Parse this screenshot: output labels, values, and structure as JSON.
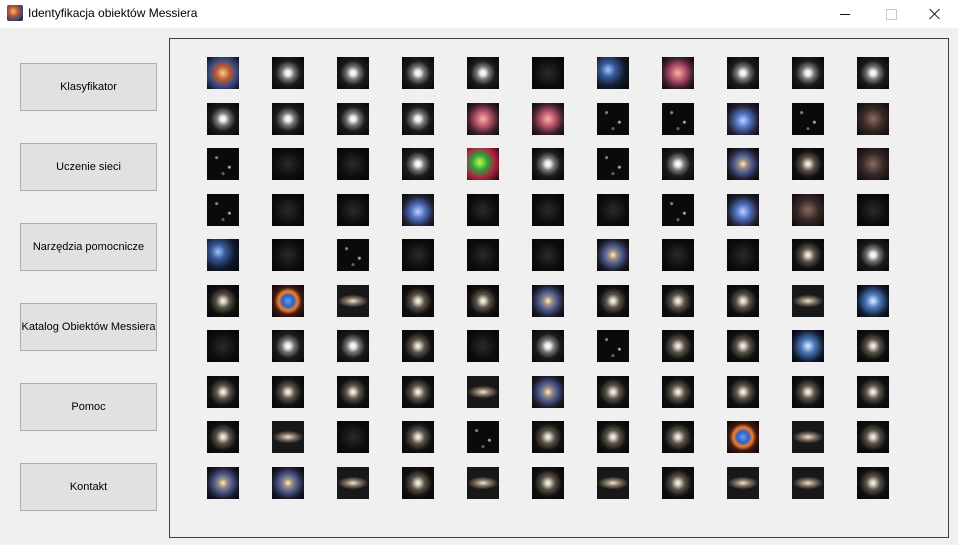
{
  "window": {
    "title": "Identyfikacja obiektów Messiera",
    "icon": "galaxy-app-icon",
    "controls": [
      "minimize-icon",
      "maximize-icon",
      "close-icon"
    ]
  },
  "sidebar": {
    "buttons": [
      {
        "label": "Klasyfikator"
      },
      {
        "label": "Uczenie sieci"
      },
      {
        "label": "Narzędzia pomocnicze"
      },
      {
        "label": "Katalog Obiektów Messiera"
      },
      {
        "label": "Pomoc"
      },
      {
        "label": "Kontakt"
      }
    ]
  },
  "gallery": {
    "rows": 10,
    "columns": 11,
    "thumbnail_count": 110,
    "thumbnails": [
      "nebula-red",
      "cluster-white",
      "cluster-white",
      "cluster-white",
      "cluster-white",
      "dark-field",
      "cluster-blue",
      "nebula-pink",
      "cluster-white",
      "cluster-white",
      "cluster-white",
      "cluster-white",
      "cluster-white",
      "cluster-white",
      "cluster-white",
      "nebula-pink",
      "nebula-pink",
      "star-field",
      "star-field",
      "nebula-blue",
      "star-field",
      "nebula-dim",
      "star-field",
      "dark-field",
      "dark-field",
      "cluster-white",
      "nebula-green",
      "cluster-white",
      "star-field",
      "cluster-white",
      "galaxy-spiral",
      "galaxy-core",
      "nebula-dim",
      "star-field",
      "dark-field",
      "dark-field",
      "nebula-blue",
      "dark-field",
      "dark-field",
      "dark-field",
      "star-field",
      "nebula-blue",
      "nebula-dim",
      "dark-field",
      "cluster-blue",
      "dark-field",
      "star-field",
      "dark-field",
      "dark-field",
      "dark-field",
      "galaxy-spiral",
      "dark-field",
      "dark-field",
      "galaxy-core",
      "cluster-white",
      "galaxy-core",
      "ring-nebula",
      "galaxy-edge",
      "galaxy-core",
      "galaxy-core",
      "galaxy-spiral",
      "galaxy-core",
      "galaxy-core",
      "galaxy-core",
      "galaxy-edge",
      "galaxy-blue",
      "dark-field",
      "cluster-white",
      "cluster-white",
      "galaxy-core",
      "dark-field",
      "cluster-white",
      "star-field",
      "galaxy-core",
      "galaxy-core",
      "galaxy-blue",
      "galaxy-core",
      "galaxy-core",
      "galaxy-core",
      "galaxy-core",
      "galaxy-core",
      "galaxy-edge",
      "galaxy-spiral",
      "galaxy-core",
      "galaxy-core",
      "galaxy-core",
      "galaxy-core",
      "galaxy-core",
      "galaxy-core",
      "galaxy-edge",
      "dark-field",
      "galaxy-core",
      "star-field",
      "galaxy-core",
      "galaxy-core",
      "galaxy-core",
      "ring-nebula",
      "galaxy-edge",
      "galaxy-core",
      "galaxy-spiral",
      "galaxy-spiral",
      "galaxy-edge",
      "galaxy-core",
      "galaxy-edge",
      "galaxy-core",
      "galaxy-edge",
      "galaxy-core",
      "galaxy-edge",
      "galaxy-edge",
      "galaxy-core"
    ]
  },
  "colors": {
    "window_bg": "#f0f0f0",
    "button_bg": "#e1e1e1",
    "button_border": "#adadad",
    "panel_border": "#404040"
  }
}
